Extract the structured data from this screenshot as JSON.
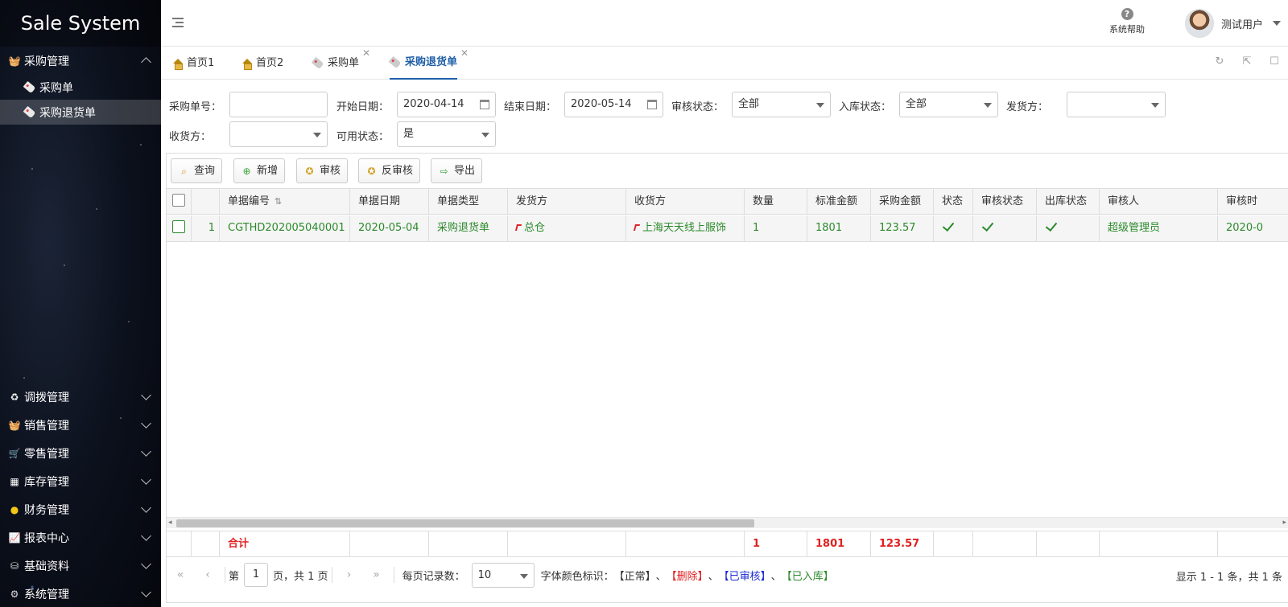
{
  "app": {
    "title": "Sale System"
  },
  "sidebar": {
    "expanded_group": {
      "label": "采购管理",
      "icon": "basket-icon"
    },
    "sub_items": [
      {
        "label": "采购单",
        "icon": "tag-icon"
      },
      {
        "label": "采购退货单",
        "icon": "tag-icon",
        "active": true
      }
    ],
    "groups": [
      {
        "label": "调拨管理",
        "icon": "transfer-icon"
      },
      {
        "label": "销售管理",
        "icon": "basket-icon"
      },
      {
        "label": "零售管理",
        "icon": "cart-icon"
      },
      {
        "label": "库存管理",
        "icon": "warehouse-icon"
      },
      {
        "label": "财务管理",
        "icon": "coins-icon"
      },
      {
        "label": "报表中心",
        "icon": "report-icon"
      },
      {
        "label": "基础资料",
        "icon": "database-icon"
      },
      {
        "label": "系统管理",
        "icon": "gear-icon"
      }
    ]
  },
  "header": {
    "help_label": "系统帮助",
    "username": "测试用户"
  },
  "tabs": [
    {
      "label": "首页1",
      "icon": "home-icon"
    },
    {
      "label": "首页2",
      "icon": "home-icon"
    },
    {
      "label": "采购单",
      "icon": "tag-icon",
      "closable": true
    },
    {
      "label": "采购退货单",
      "icon": "tag-icon",
      "closable": true,
      "active": true
    }
  ],
  "filters": {
    "order_no_label": "采购单号：",
    "order_no_value": "",
    "start_date_label": "开始日期：",
    "start_date_value": "2020-04-14",
    "end_date_label": "结束日期：",
    "end_date_value": "2020-05-14",
    "audit_status_label": "审核状态：",
    "audit_status_value": "全部",
    "instock_status_label": "入库状态：",
    "instock_status_value": "全部",
    "sender_label": "发货方：",
    "sender_value": "",
    "receiver_label": "收货方：",
    "receiver_value": "",
    "available_label": "可用状态：",
    "available_value": "是"
  },
  "toolbar": {
    "query": "查询",
    "add": "新增",
    "audit": "审核",
    "unaudit": "反审核",
    "export": "导出"
  },
  "table": {
    "columns": [
      "单据编号",
      "单据日期",
      "单据类型",
      "发货方",
      "收货方",
      "数量",
      "标准金额",
      "采购金额",
      "状态",
      "审核状态",
      "出库状态",
      "审核人",
      "审核时"
    ],
    "rows": [
      {
        "index": "1",
        "bill_no": "CGTHD202005040001",
        "bill_date": "2020-05-04",
        "bill_type": "采购退货单",
        "sender": "总仓",
        "receiver": "上海天天线上服饰",
        "qty": "1",
        "std_amount": "1801",
        "purchase_amount": "123.57",
        "status": true,
        "audit_status": true,
        "out_status": true,
        "auditor": "超级管理员",
        "audit_time": "2020-0"
      }
    ],
    "footer": {
      "label": "合计",
      "qty": "1",
      "std_amount": "1801",
      "purchase_amount": "123.57"
    }
  },
  "pager": {
    "page_prefix": "第",
    "page_value": "1",
    "page_suffix": "页，共 1 页",
    "page_size_label": "每页记录数：",
    "page_size_value": "10",
    "legend_label": "字体颜色标识：",
    "legend_normal": "【正常】",
    "legend_sep": "、",
    "legend_deleted": "【删除】",
    "legend_audited": "【已审核】",
    "legend_instock": "【已入库】",
    "info": "显示 1 - 1 条，共 1 条"
  },
  "colors": {
    "accent": "#1e5fa8",
    "normal_text": "#333333",
    "deleted_text": "#e02020",
    "audited_text": "#1d2bd6",
    "instock_text": "#2c8a2c"
  }
}
